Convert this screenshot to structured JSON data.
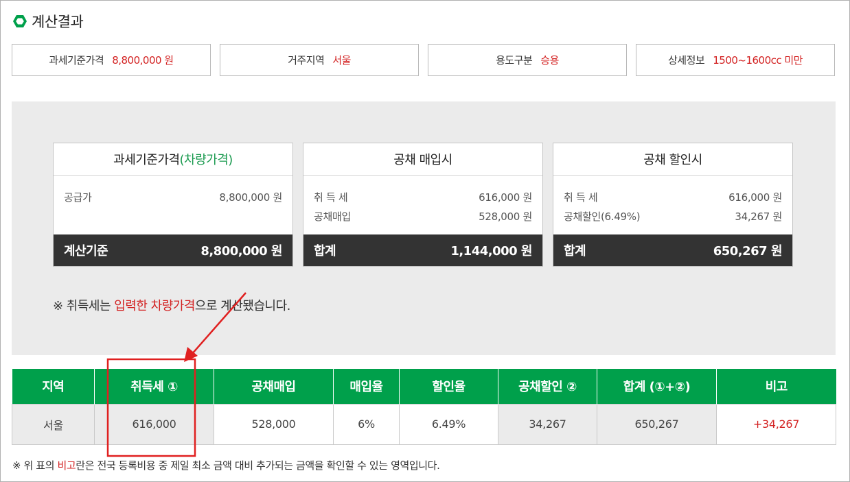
{
  "header": {
    "title": "계산결과",
    "icon": "hexagon-icon"
  },
  "summary": [
    {
      "label": "과세기준가격",
      "value": "8,800,000 원"
    },
    {
      "label": "거주지역",
      "value": "서울"
    },
    {
      "label": "용도구분",
      "value": "승용"
    },
    {
      "label": "상세정보",
      "value": "1500~1600cc 미만"
    }
  ],
  "cards": {
    "base": {
      "title": "과세기준가격",
      "title_accent": "(차량가격)",
      "rows": [
        {
          "label": "공급가",
          "value": "8,800,000 원"
        }
      ],
      "footer_label": "계산기준",
      "footer_value": "8,800,000 원"
    },
    "purchase": {
      "title": "공채 매입시",
      "rows": [
        {
          "label": "취 득 세",
          "value": "616,000 원"
        },
        {
          "label": "공채매입",
          "value": "528,000 원"
        }
      ],
      "footer_label": "합계",
      "footer_value": "1,144,000 원"
    },
    "discount": {
      "title": "공채 할인시",
      "rows": [
        {
          "label": "취 득 세",
          "value": "616,000 원"
        },
        {
          "label": "공채할인(6.49%)",
          "value": "34,267 원"
        }
      ],
      "footer_label": "합계",
      "footer_value": "650,267 원"
    }
  },
  "notice": {
    "prefix": "※ 취득세는 ",
    "highlight": "입력한 차량가격",
    "suffix": "으로 계산됐습니다."
  },
  "table": {
    "headers": [
      "지역",
      "취득세 ①",
      "공채매입",
      "매입율",
      "할인율",
      "공채할인 ②",
      "합계 (①+②)",
      "비고"
    ],
    "row": [
      "서울",
      "616,000",
      "528,000",
      "6%",
      "6.49%",
      "34,267",
      "650,267",
      "+34,267"
    ]
  },
  "footnote": {
    "prefix": "※ 위 표의 ",
    "highlight": "비고",
    "suffix": "란은 전국 등록비용 중 제일 최소 금액 대비 추가되는 금액을 확인할 수 있는 영역입니다."
  },
  "colors": {
    "accent_green": "#00a04b",
    "accent_red": "#d32222",
    "dark_footer": "#333333",
    "panel_gray": "#ebebeb",
    "annotation_red": "#e02020"
  }
}
